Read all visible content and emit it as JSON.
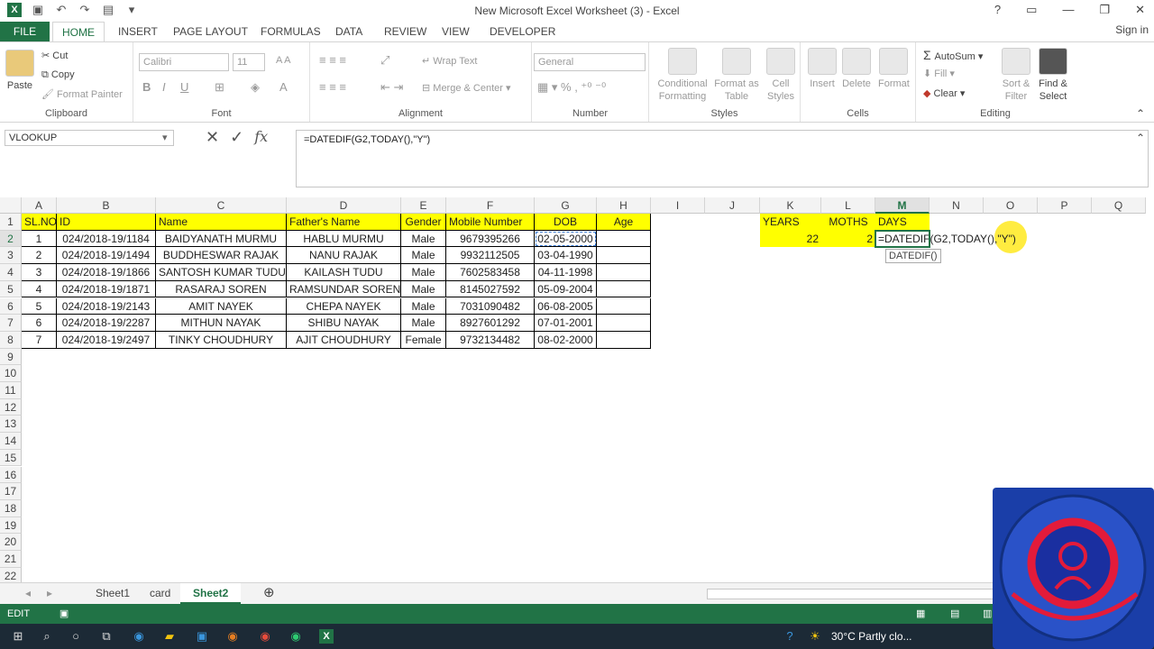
{
  "window": {
    "title": "New Microsoft Excel Worksheet (3) - Excel",
    "signin": "Sign in"
  },
  "tabs": [
    "FILE",
    "HOME",
    "INSERT",
    "PAGE LAYOUT",
    "FORMULAS",
    "DATA",
    "REVIEW",
    "VIEW",
    "DEVELOPER"
  ],
  "ribbon": {
    "clipboard": {
      "label": "Clipboard",
      "paste": "Paste",
      "cut": "Cut",
      "copy": "Copy",
      "format_painter": "Format Painter"
    },
    "font": {
      "label": "Font",
      "name": "Calibri",
      "size": "11"
    },
    "alignment": {
      "label": "Alignment",
      "wrap": "Wrap Text",
      "merge": "Merge & Center"
    },
    "number": {
      "label": "Number",
      "format": "General"
    },
    "styles": {
      "label": "Styles",
      "conditional": "Conditional Formatting",
      "format_table": "Format as Table",
      "cell_styles": "Cell Styles"
    },
    "cells": {
      "label": "Cells",
      "insert": "Insert",
      "delete": "Delete",
      "format": "Format"
    },
    "editing": {
      "label": "Editing",
      "autosum": "AutoSum",
      "fill": "Fill",
      "clear": "Clear",
      "sort": "Sort & Filter",
      "find": "Find & Select"
    }
  },
  "formula_bar": {
    "name_box": "VLOOKUP",
    "formula": "=DATEDIF(G2,TODAY(),\"Y\")"
  },
  "columns": [
    "A",
    "B",
    "C",
    "D",
    "E",
    "F",
    "G",
    "H",
    "I",
    "J",
    "K",
    "L",
    "M",
    "N",
    "O",
    "P",
    "Q"
  ],
  "rows": [
    "1",
    "2",
    "3",
    "4",
    "5",
    "6",
    "7",
    "8",
    "9",
    "10",
    "11",
    "12",
    "13",
    "14",
    "15",
    "16",
    "17",
    "18",
    "19",
    "20",
    "21",
    "22"
  ],
  "headers": [
    "SL.NO",
    "ID",
    "Name",
    "Father's Name",
    "Gender",
    "Mobile Number",
    "DOB",
    "Age"
  ],
  "table": [
    [
      "1",
      "024/2018-19/1184",
      "BAIDYANATH MURMU",
      "HABLU MURMU",
      "Male",
      "9679395266",
      "02-05-2000"
    ],
    [
      "2",
      "024/2018-19/1494",
      "BUDDHESWAR RAJAK",
      "NANU RAJAK",
      "Male",
      "9932112505",
      "03-04-1990"
    ],
    [
      "3",
      "024/2018-19/1866",
      "SANTOSH KUMAR TUDU",
      "KAILASH TUDU",
      "Male",
      "7602583458",
      "04-11-1998"
    ],
    [
      "4",
      "024/2018-19/1871",
      "RASARAJ SOREN",
      "RAMSUNDAR SOREN",
      "Male",
      "8145027592",
      "05-09-2004"
    ],
    [
      "5",
      "024/2018-19/2143",
      "AMIT NAYEK",
      "CHEPA NAYEK",
      "Male",
      "7031090482",
      "06-08-2005"
    ],
    [
      "6",
      "024/2018-19/2287",
      "MITHUN NAYAK",
      "SHIBU NAYAK",
      "Male",
      "8927601292",
      "07-01-2001"
    ],
    [
      "7",
      "024/2018-19/2497",
      "TINKY CHOUDHURY",
      "AJIT CHOUDHURY",
      "Female",
      "9732134482",
      "08-02-2000"
    ]
  ],
  "side": {
    "years": "YEARS",
    "moths": "MOTHS",
    "days": "DAYS",
    "years_val": "22",
    "moths_val": "2",
    "editing": "=DATEDIF(G2,TODAY(),\"Y\")",
    "tooltip": "DATEDIF()"
  },
  "sheets": [
    "Sheet1",
    "card",
    "Sheet2"
  ],
  "status": {
    "mode": "EDIT"
  },
  "taskbar": {
    "weather": "30°C  Partly clo..."
  }
}
